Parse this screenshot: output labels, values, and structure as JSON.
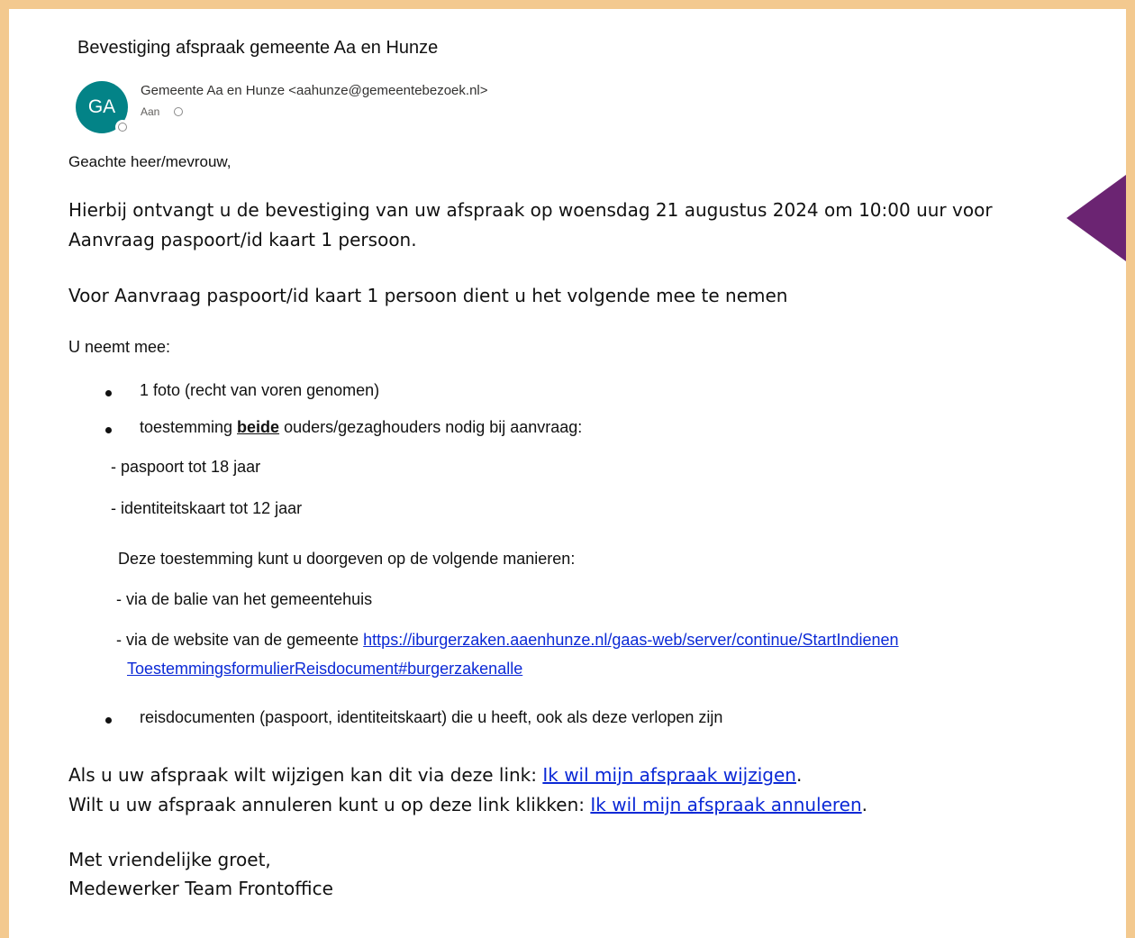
{
  "email": {
    "subject": "Bevestiging afspraak gemeente Aa en Hunze",
    "avatar_initials": "GA",
    "sender": "Gemeente Aa en Hunze <aahunze@gemeentebezoek.nl>",
    "to_label": "Aan"
  },
  "body": {
    "greeting": "Geachte heer/mevrouw,",
    "intro_line1": "Hierbij ontvangt u de bevestiging van uw afspraak op woensdag 21 augustus 2024 om 10:00 uur voor",
    "intro_line2": "Aanvraag paspoort/id kaart 1 persoon.",
    "bring_line": "Voor Aanvraag paspoort/id kaart 1 persoon dient u het volgende mee te nemen",
    "bring_label": "U neemt mee:",
    "item1": "1 foto (recht van voren genomen)",
    "item2_pre": "toestemming ",
    "item2_bold": "beide",
    "item2_post": " ouders/gezaghouders nodig bij aanvraag:",
    "sub1": "- paspoort tot 18 jaar",
    "sub2": "- identiteitskaart tot 12 jaar",
    "consent_intro": "Deze toestemming kunt u doorgeven op de volgende manieren:",
    "way1": "- via de balie van het gemeentehuis",
    "way2_pre": "- via de website van de gemeente ",
    "way2_link_line1": "https://iburgerzaken.aaenhunze.nl/gaas-web/server/continue/StartIndienen",
    "way2_link_line2": "ToestemmingsformulierReisdocument#burgerzakenalle",
    "item3": "reisdocumenten (paspoort, identiteitskaart) die u heeft, ook als deze verlopen zijn",
    "change_pre": "Als u uw afspraak wilt wijzigen kan dit via deze link: ",
    "change_link": "Ik wil mijn afspraak wijzigen",
    "change_post": ".",
    "cancel_pre": "Wilt u uw afspraak annuleren kunt u op deze link klikken: ",
    "cancel_link": "Ik wil mijn afspraak annuleren",
    "cancel_post": ".",
    "closing": "Met vriendelijke groet,",
    "signature": "Medewerker Team Frontoffice"
  },
  "colors": {
    "frame": "#f3c98f",
    "avatar": "#038387",
    "link": "#0b29d6",
    "arrow": "#6b2472"
  },
  "icons": {
    "status": "presence-circle-icon",
    "annotation": "arrow-left-icon"
  }
}
